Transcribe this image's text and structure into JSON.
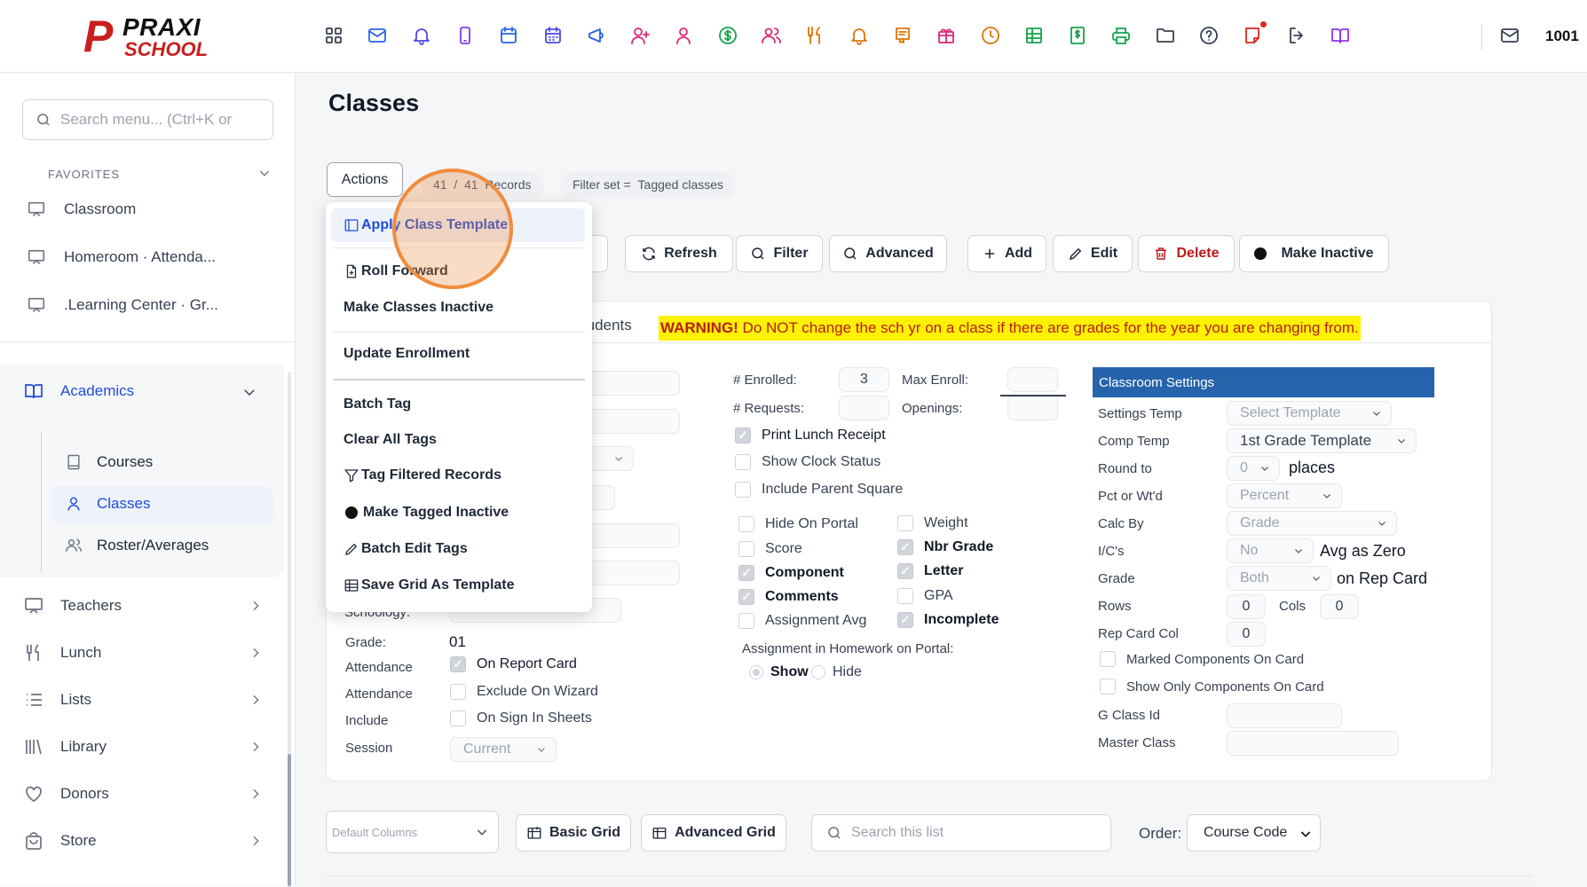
{
  "header": {
    "logo_top": "PRAXI",
    "logo_bottom": "SCHOOL",
    "logo_letter": "P",
    "user_id": "1001",
    "icons": [
      "apps-icon",
      "mail-icon",
      "bell-icon",
      "phone-icon",
      "calendar-icon",
      "calendar-grid-icon",
      "megaphone-icon",
      "user-plus-icon",
      "user-icon",
      "dollar-icon",
      "users-icon",
      "utensils-icon",
      "bell-alert-icon",
      "certificate-icon",
      "gift-icon",
      "clock-icon",
      "table-icon",
      "invoice-icon",
      "printer-icon",
      "folder-icon",
      "help-icon",
      "note-icon",
      "logout-icon",
      "book-open-icon"
    ],
    "icon_colors": [
      "#374151",
      "#2563eb",
      "#4f46e5",
      "#7c3aed",
      "#2563eb",
      "#4f46e5",
      "#2563eb",
      "#db2777",
      "#db2777",
      "#16a34a",
      "#db2777",
      "#d97706",
      "#d97706",
      "#d97706",
      "#db2777",
      "#d97706",
      "#16a34a",
      "#16a34a",
      "#16a34a",
      "#374151",
      "#374151",
      "#dc2626",
      "#374151",
      "#9333ea"
    ]
  },
  "sidebar": {
    "search_placeholder": "Search menu... (Ctrl+K or",
    "favorites_label": "FAVORITES",
    "favorites": [
      "Classroom",
      "Homeroom · Attenda...",
      ".Learning Center · Gr..."
    ],
    "academics_label": "Academics",
    "academics_sub": [
      "Courses",
      "Classes",
      "Roster/Averages"
    ],
    "menu": [
      "Teachers",
      "Lunch",
      "Lists",
      "Library",
      "Donors",
      "Store"
    ]
  },
  "page": {
    "title": "Classes",
    "actions_label": "Actions",
    "records_count": "41  /  41",
    "records_label": "Records",
    "filter_label": "Filter set =",
    "filter_value": "Tagged classes"
  },
  "toolbar": {
    "refresh": "Refresh",
    "filter": "Filter",
    "advanced": "Advanced",
    "add": "Add",
    "edit": "Edit",
    "delete": "Delete",
    "make_inactive": "Make Inactive"
  },
  "actions_menu": {
    "items": [
      "Apply Class Template",
      "Roll Forward",
      "Make Classes Inactive",
      "Update Enrollment",
      "Batch Tag",
      "Clear All Tags",
      "Tag Filtered Records",
      "Make Tagged Inactive",
      "Batch Edit Tags",
      "Save Grid As Template"
    ]
  },
  "form": {
    "tab_students": "tudents",
    "warning_bold": "WARNING!",
    "warning_text": " Do NOT change the sch yr on a class if there are grades for the year you are changing from.",
    "schoology_label": "Schoology:",
    "grade_label": "Grade:",
    "grade_value": "01",
    "attendance_label_1": "Attendance",
    "attendance_label_2": "Attendance",
    "include_label": "Include",
    "session_label": "Session",
    "on_report_card": "On Report Card",
    "exclude_on_wizard": "Exclude On Wizard",
    "on_sign_in_sheets": "On Sign In Sheets",
    "session_value": "Current",
    "enrolled_label": "# Enrolled:",
    "enrolled_value": "3",
    "requests_label": "# Requests:",
    "max_enroll_label": "Max Enroll:",
    "openings_label": "Openings:",
    "print_lunch_receipt": "Print Lunch Receipt",
    "show_clock_status": "Show Clock Status",
    "include_parent_square": "Include Parent Square",
    "hide_on_portal": "Hide On Portal",
    "score": "Score",
    "component": "Component",
    "comments": "Comments",
    "assignment_avg": "Assignment Avg",
    "weight": "Weight",
    "nbr_grade": "Nbr Grade",
    "letter": "Letter",
    "gpa": "GPA",
    "incomplete": "Incomplete",
    "assignment_homework_label": "Assignment in Homework on Portal:",
    "show": "Show",
    "hide": "Hide"
  },
  "classroom_settings": {
    "title": "Classroom Settings",
    "settings_temp_label": "Settings Temp",
    "settings_temp_value": "Select Template",
    "comp_temp_label": "Comp Temp",
    "comp_temp_value": "1st Grade Template",
    "round_to_label": "Round to",
    "round_to_value": "0",
    "places": "places",
    "pct_label": "Pct or Wt'd",
    "pct_value": "Percent",
    "calc_by_label": "Calc By",
    "calc_by_value": "Grade",
    "ics_label": "I/C's",
    "ics_value": "No",
    "avg_as_zero": "Avg as Zero",
    "grade_label": "Grade",
    "grade_value": "Both",
    "on_rep_card": "on Rep Card",
    "rows_label": "Rows",
    "rows_value": "0",
    "cols_label": "Cols",
    "cols_value": "0",
    "rep_card_col_label": "Rep Card Col",
    "rep_card_col_value": "0",
    "marked_components": "Marked Components On Card",
    "show_only_components": "Show Only Components On Card",
    "g_class_id_label": "G Class Id",
    "master_class_label": "Master Class"
  },
  "grid_controls": {
    "columns_value": "Default Columns",
    "basic_grid": "Basic Grid",
    "advanced_grid": "Advanced Grid",
    "search_placeholder": "Search this list",
    "order_label": "Order:",
    "order_value": "Course Code"
  },
  "colors": {
    "accent": "#1d4ed8",
    "warning_bg": "#fff200",
    "warning_text": "#b91c1c",
    "highlight_circle": "#f08c3e",
    "settings_header": "#2563ab"
  }
}
